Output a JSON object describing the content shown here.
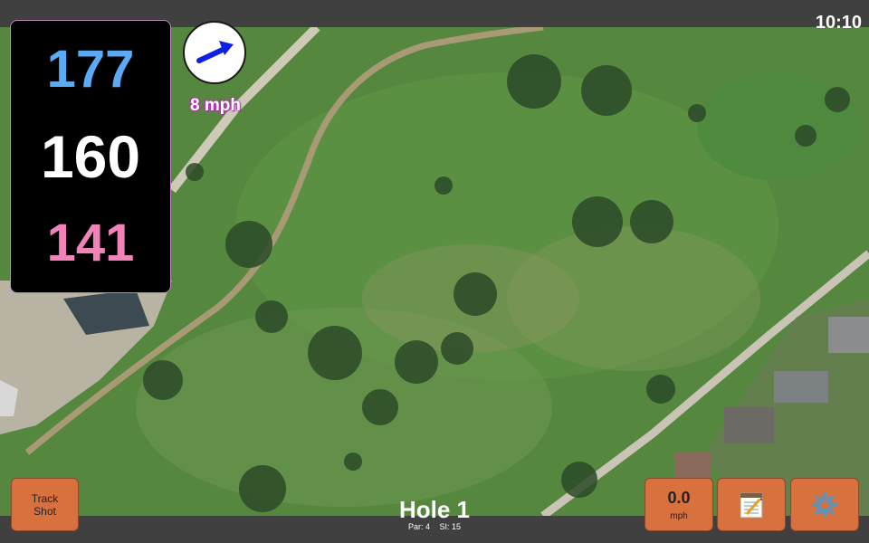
{
  "status": {
    "clock": "10:10"
  },
  "distances": {
    "back": "177",
    "middle": "160",
    "front": "141"
  },
  "wind": {
    "speed": "8 mph",
    "direction_icon": "arrow-right-up-icon",
    "arrow_color": "#1020e0"
  },
  "hole": {
    "title": "Hole 1",
    "par": "Par: 4",
    "stroke_index": "SI: 15"
  },
  "buttons": {
    "track_shot": "Track Shot",
    "speed_value": "0.0",
    "speed_unit": "mph",
    "notes_icon": "notepad-icon",
    "settings_icon": "gear-icon"
  },
  "colors": {
    "back": "#5aaaf5",
    "middle": "#ffffff",
    "front": "#f283b9",
    "button": "#d9713e",
    "fairway": "#4f8a3c"
  }
}
